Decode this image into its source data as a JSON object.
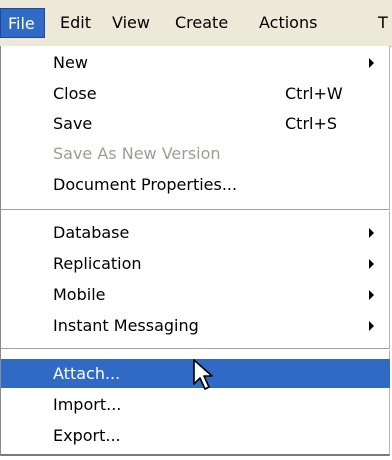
{
  "menubar": {
    "items": [
      {
        "label": "File"
      },
      {
        "label": "Edit"
      },
      {
        "label": "View"
      },
      {
        "label": "Create"
      },
      {
        "label": "Actions"
      },
      {
        "label": "T"
      }
    ]
  },
  "file_menu": {
    "group1": [
      {
        "label": "New",
        "shortcut": ""
      },
      {
        "label": "Close",
        "shortcut": "Ctrl+W"
      },
      {
        "label": "Save",
        "shortcut": "Ctrl+S"
      },
      {
        "label": "Save As New Version",
        "shortcut": ""
      },
      {
        "label": "Document Properties...",
        "shortcut": ""
      }
    ],
    "group2": [
      {
        "label": "Database"
      },
      {
        "label": "Replication"
      },
      {
        "label": "Mobile"
      },
      {
        "label": "Instant Messaging"
      }
    ],
    "group3": [
      {
        "label": "Attach..."
      },
      {
        "label": "Import..."
      },
      {
        "label": "Export..."
      }
    ]
  },
  "icons": {
    "submenu_arrow": "chevron-right-icon",
    "pointer": "mouse-pointer-icon"
  },
  "colors": {
    "highlight": "#316ac5",
    "menubar_bg": "#ece9d8",
    "disabled_text": "#a09c94"
  }
}
